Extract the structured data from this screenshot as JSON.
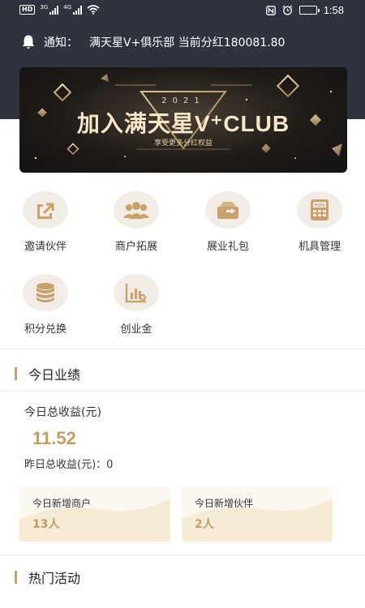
{
  "status_bar": {
    "hd": "HD",
    "net1": "3G",
    "net2": "4G",
    "time": "1:58"
  },
  "notice": {
    "label": "通知：",
    "text": "满天星V+俱乐部 当前分红180081.80"
  },
  "banner": {
    "year": "2021",
    "title": "加入满天星V⁺CLUB",
    "subtitle": "享受更多分红权益"
  },
  "menu": [
    {
      "label": "邀请伙伴",
      "icon": "share-icon"
    },
    {
      "label": "商户拓展",
      "icon": "users-icon"
    },
    {
      "label": "展业礼包",
      "icon": "gift-box-icon"
    },
    {
      "label": "机具管理",
      "icon": "pos-icon"
    },
    {
      "label": "积分兑换",
      "icon": "coins-icon"
    },
    {
      "label": "创业金",
      "icon": "chart-icon"
    }
  ],
  "today": {
    "section_title": "今日业绩",
    "total_label": "今日总收益(元)",
    "total_value": "11.52",
    "yesterday_label": "昨日总收益(元)：",
    "yesterday_value": "0",
    "cards": [
      {
        "label": "今日新增商户",
        "value": "13人"
      },
      {
        "label": "今日新增伙伴",
        "value": "2人"
      }
    ]
  },
  "hot": {
    "section_title": "热门活动"
  },
  "colors": {
    "header_bg": "#2f3340",
    "accent_gold": "#c9a16a",
    "icon_bg": "#f1ece6"
  }
}
